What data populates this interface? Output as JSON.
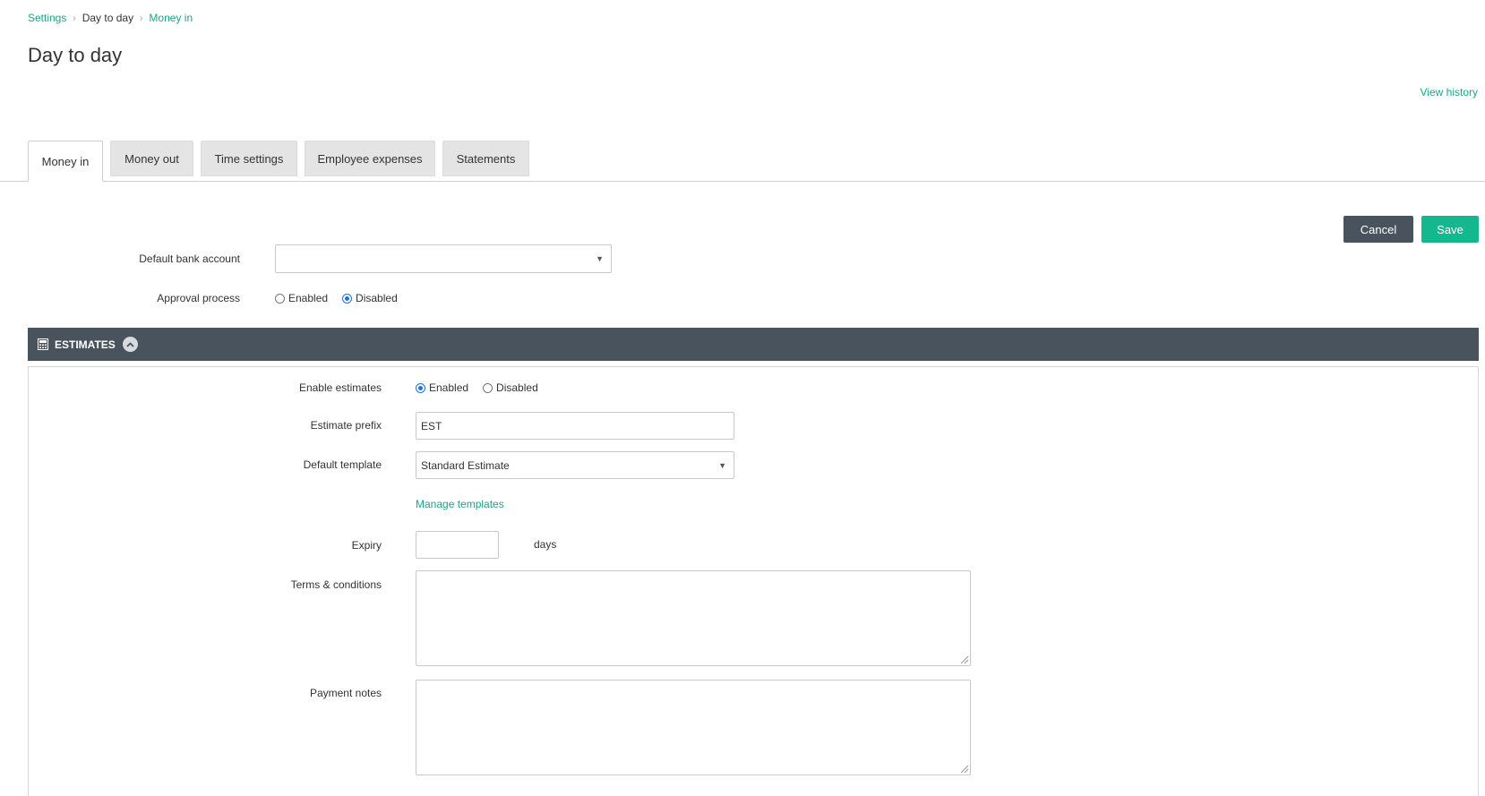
{
  "breadcrumb": {
    "items": [
      "Settings",
      "Day to day",
      "Money in"
    ]
  },
  "page": {
    "title": "Day to day",
    "view_history": "View history"
  },
  "tabs": [
    {
      "label": "Money in",
      "active": true
    },
    {
      "label": "Money out",
      "active": false
    },
    {
      "label": "Time settings",
      "active": false
    },
    {
      "label": "Employee expenses",
      "active": false
    },
    {
      "label": "Statements",
      "active": false
    }
  ],
  "actions": {
    "cancel": "Cancel",
    "save": "Save"
  },
  "general": {
    "default_bank_account_label": "Default bank account",
    "default_bank_account_value": "",
    "approval_process_label": "Approval process",
    "approval_options": [
      "Enabled",
      "Disabled"
    ],
    "approval_selected": "Disabled"
  },
  "estimates": {
    "header": "ESTIMATES",
    "enable_label": "Enable estimates",
    "enable_options": [
      "Enabled",
      "Disabled"
    ],
    "enable_selected": "Enabled",
    "prefix_label": "Estimate prefix",
    "prefix_value": "EST",
    "template_label": "Default template",
    "template_value": "Standard Estimate",
    "manage_templates": "Manage templates",
    "expiry_label": "Expiry",
    "expiry_value": "",
    "expiry_unit": "days",
    "terms_label": "Terms & conditions",
    "terms_value": "",
    "payment_notes_label": "Payment notes",
    "payment_notes_value": ""
  },
  "colors": {
    "accent": "#14b88e",
    "link": "#1aa68a",
    "header_bg": "#48535d",
    "radio_checked": "#1e73d8"
  },
  "icons": {
    "breadcrumb_separator": "chevron-right-icon",
    "select_caret": "caret-down-icon",
    "section_icon": "calculator-icon",
    "collapse": "chevron-up-icon"
  }
}
